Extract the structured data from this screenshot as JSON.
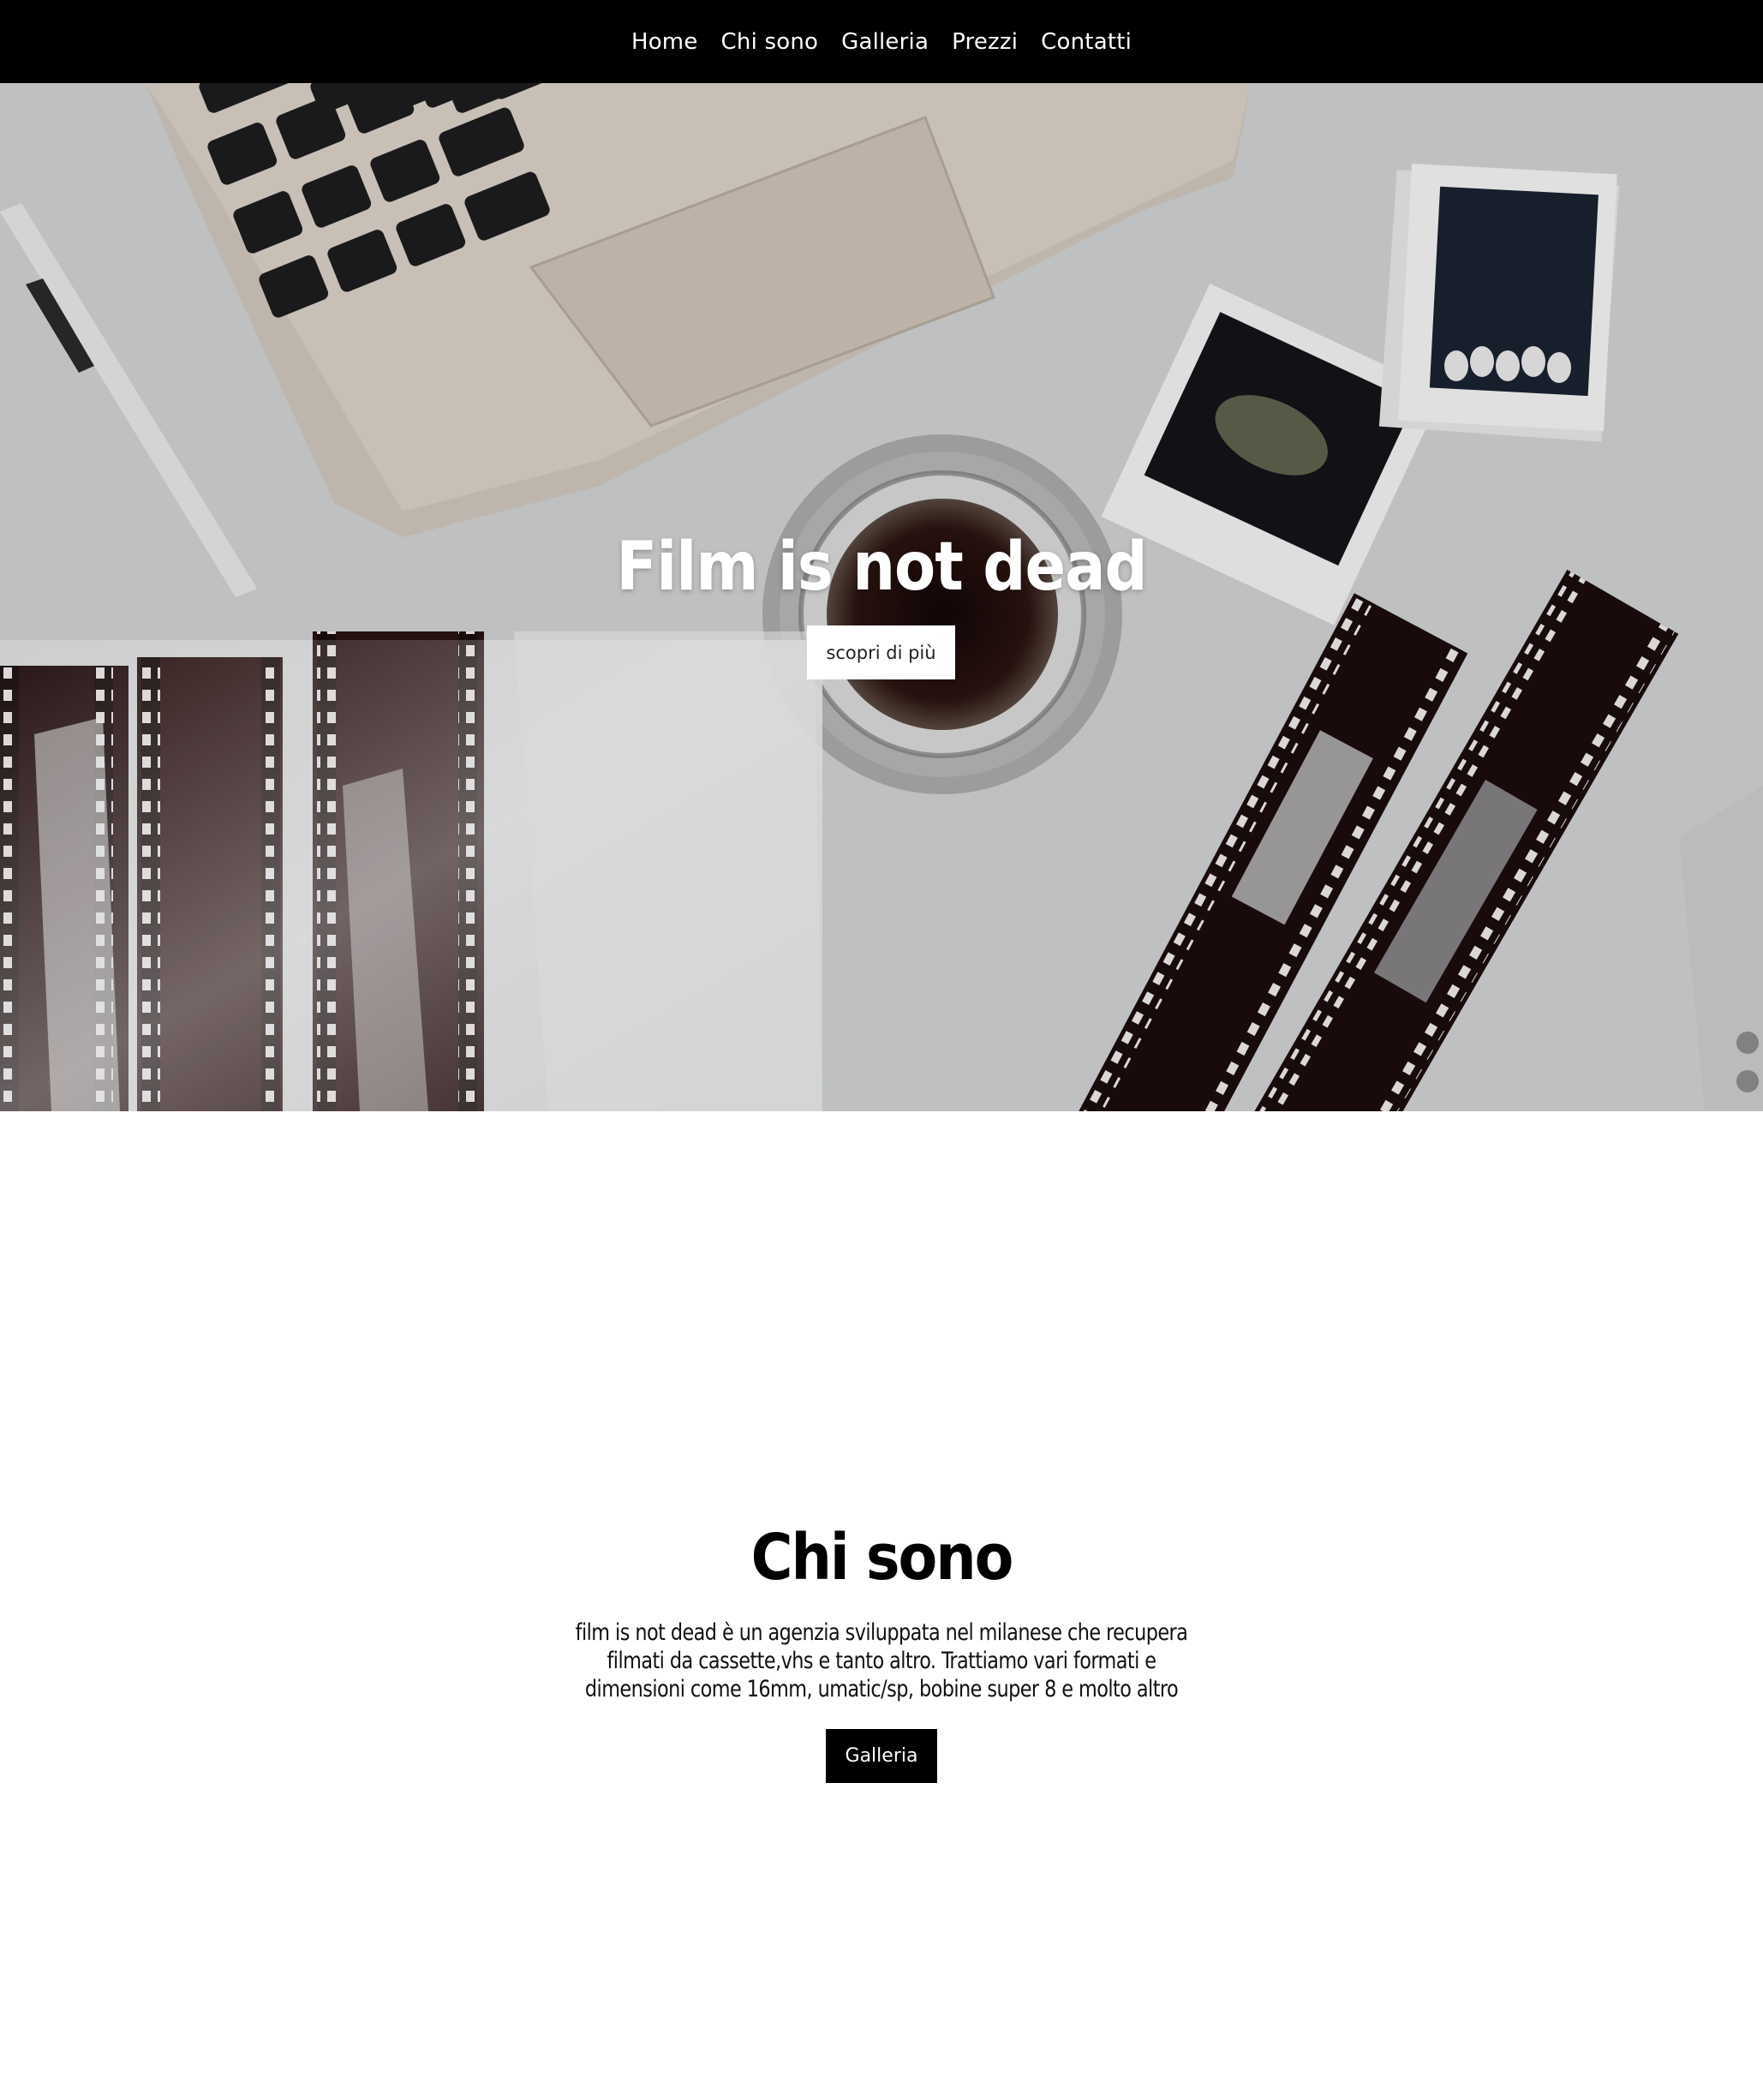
{
  "nav": {
    "items": [
      {
        "label": "Home"
      },
      {
        "label": "Chi sono"
      },
      {
        "label": "Galleria"
      },
      {
        "label": "Prezzi"
      },
      {
        "label": "Contatti"
      }
    ]
  },
  "hero": {
    "title": "Film is not dead",
    "button_label": "scopri di più"
  },
  "about": {
    "title": "Chi sono",
    "text": "film is not dead è un agenzia sviluppata nel milanese che recupera filmati da cassette,vhs e tanto altro. Trattiamo vari formati e dimensioni come 16mm, umatic/sp, bobine super 8 e molto altro",
    "button_label": "Galleria"
  },
  "colors": {
    "nav_background": "#000000",
    "nav_text": "#ffffff",
    "primary_button": "#000000",
    "hero_button": "#ffffff"
  }
}
